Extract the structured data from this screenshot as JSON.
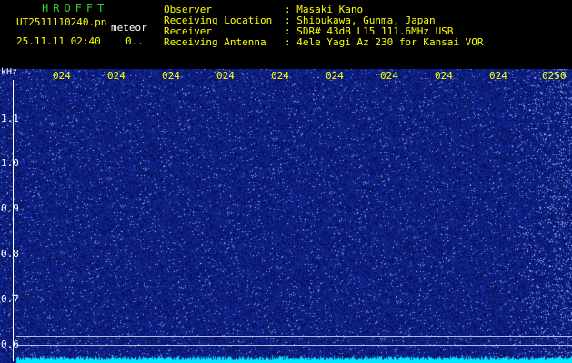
{
  "header": {
    "app_title": "HROFFT",
    "file_name": "UT2511110240.pn",
    "meteor_label": "meteor",
    "datetime": "25.11.11 02:40",
    "count": "0..",
    "observer_label": "Observer",
    "observer_value": ": Masaki Kano",
    "location_label": "Receiving Location",
    "location_value": ": Shibukawa, Gunma, Japan",
    "receiver_label": "Receiver",
    "receiver_value": ": SDR# 43dB L15 111.6MHz USB",
    "antenna_label": "Receiving Antenna",
    "antenna_value": ": 4ele Yagi Az 230 for Kansai VOR"
  },
  "axes": {
    "y_unit": "kHz",
    "y_ticks": [
      "1.1",
      "1.0",
      "0.9",
      "0.8",
      "0.7",
      "0.6"
    ],
    "x_ticks": [
      "024",
      "024",
      "024",
      "024",
      "024",
      "024",
      "024",
      "024",
      "024",
      "0250"
    ]
  },
  "colors": {
    "background": "#0a1168",
    "title": "#2ed02e",
    "header_text": "#ffff00",
    "axis_text": "#ffffff",
    "noise_floor": "#00e5ff"
  }
}
